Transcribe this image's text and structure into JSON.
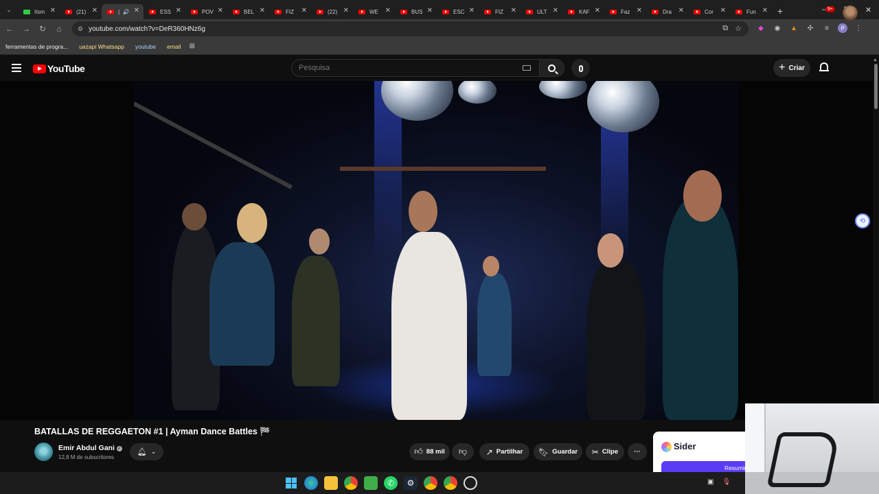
{
  "browser": {
    "tabs": [
      {
        "label": "Itsm",
        "favicon": "green-k-icon",
        "active": false
      },
      {
        "label": "(21)",
        "favicon": "youtube-icon",
        "active": false
      },
      {
        "label": "(",
        "favicon": "youtube-icon",
        "active": true,
        "audio": "🔊"
      },
      {
        "label": "ESS",
        "favicon": "youtube-icon",
        "active": false
      },
      {
        "label": "POV",
        "favicon": "youtube-icon",
        "active": false
      },
      {
        "label": "BEL",
        "favicon": "youtube-icon",
        "active": false
      },
      {
        "label": "FIZ",
        "favicon": "youtube-icon",
        "active": false
      },
      {
        "label": "(22)",
        "favicon": "youtube-icon",
        "active": false
      },
      {
        "label": "WE",
        "favicon": "youtube-icon",
        "active": false
      },
      {
        "label": "BUS",
        "favicon": "youtube-icon",
        "active": false
      },
      {
        "label": "ESC",
        "favicon": "youtube-icon",
        "active": false
      },
      {
        "label": "FIZ",
        "favicon": "youtube-icon",
        "active": false
      },
      {
        "label": "ULT",
        "favicon": "youtube-icon",
        "active": false
      },
      {
        "label": "KAF",
        "favicon": "youtube-icon",
        "active": false
      },
      {
        "label": "Faz",
        "favicon": "youtube-icon",
        "active": false
      },
      {
        "label": "Dra",
        "favicon": "youtube-icon",
        "active": false
      },
      {
        "label": "Cor",
        "favicon": "youtube-icon",
        "active": false
      },
      {
        "label": "Fun",
        "favicon": "youtube-icon",
        "active": false
      }
    ],
    "url": "youtube.com/watch?v=DeR360HNz6g",
    "bookmarks": [
      "ferramentas de progra...",
      "uazapi Whatsapp",
      "youtube",
      "email"
    ]
  },
  "youtube": {
    "logo_text": "YouTube",
    "search_placeholder": "Pesquisa",
    "create_label": "Criar",
    "notifications_badge": "9+"
  },
  "video": {
    "title": "BATALLAS DE REGGAETON #1 | Ayman Dance Battles 🏁",
    "channel_name": "Emir Abdul Gani",
    "subscribers": "12,8 M de subscritores",
    "likes": "88 mil",
    "share_label": "Partilhar",
    "save_label": "Guardar",
    "clip_label": "Clipe",
    "more_label": "···"
  },
  "sider": {
    "name": "Sider",
    "button_label": "Resumir"
  },
  "colors": {
    "youtube_red": "#ff0000",
    "sider_purple": "#5b3cf5",
    "background": "#0f0f0f"
  }
}
